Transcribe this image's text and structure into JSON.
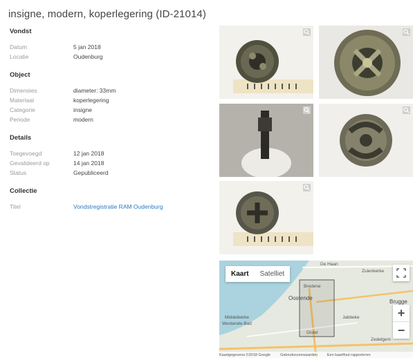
{
  "title": "insigne, modern, koperlegering (ID-21014)",
  "sections": {
    "vondst": {
      "title": "Vondst",
      "rows": [
        {
          "key": "Datum",
          "value": "5 jan 2018"
        },
        {
          "key": "Locatie",
          "value": "Oudenburg"
        }
      ]
    },
    "object": {
      "title": "Object",
      "rows": [
        {
          "key": "Dimensies",
          "value": "diameter: 33mm"
        },
        {
          "key": "Materiaal",
          "value": "koperlegering"
        },
        {
          "key": "Categorie",
          "value": "insigne"
        },
        {
          "key": "Periode",
          "value": "modern"
        }
      ]
    },
    "details": {
      "title": "Details",
      "rows": [
        {
          "key": "Toegevoegd",
          "value": "12 jan 2018"
        },
        {
          "key": "Gevalideerd op",
          "value": "14 jan 2018"
        },
        {
          "key": "Status",
          "value": "Gepubliceerd"
        }
      ]
    },
    "collectie": {
      "title": "Collectie",
      "rows": [
        {
          "key": "Titel",
          "value": "Vondstregistratie RAM Oudenburg"
        }
      ]
    }
  },
  "map": {
    "type_options": [
      "Kaart",
      "Satelliet"
    ],
    "selected_type": "Kaart",
    "zoom_in": "+",
    "zoom_out": "−",
    "place_labels": [
      "De Haan",
      "Zuienkerke",
      "Bredene",
      "Oostende",
      "Brugge",
      "Middelkerke",
      "Westende-Bad",
      "Jabbeke",
      "Zedelgem",
      "Gistel"
    ],
    "footer": [
      "Kaartgegevens ©2018 Google",
      "Gebruiksvoorwaarden",
      "Een kaartfout rapporteren"
    ]
  },
  "icons": {
    "photo_zoom": "magnifier-icon",
    "fullscreen": "fullscreen-icon"
  }
}
